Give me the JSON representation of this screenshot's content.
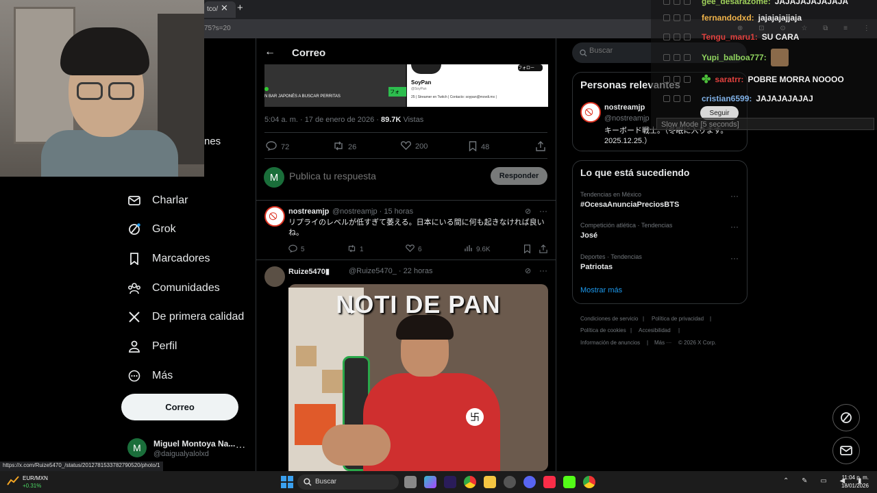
{
  "browser": {
    "tab_title": "tco/",
    "url": "75?s=20",
    "status_url": "https://x.com/Ruize5470_/status/2012781533782790520/photo/1"
  },
  "sidebar": {
    "partial_label": "nes",
    "items": [
      {
        "label": "Charlar",
        "icon": "envelope-icon"
      },
      {
        "label": "Grok",
        "icon": "grok-icon"
      },
      {
        "label": "Marcadores",
        "icon": "bookmark-icon"
      },
      {
        "label": "Comunidades",
        "icon": "communities-icon"
      },
      {
        "label": "De primera calidad",
        "icon": "x-logo-icon"
      },
      {
        "label": "Perfil",
        "icon": "person-icon"
      },
      {
        "label": "Más",
        "icon": "more-circle-icon"
      }
    ],
    "post_button": "Correo",
    "account": {
      "avatar_letter": "M",
      "name": "Miguel Montoya Na...",
      "handle": "@daigualyalolxd",
      "more": "···"
    }
  },
  "main": {
    "header_title": "Correo",
    "embed": {
      "caption": "N BAR JAPONÉS A BUSCAR PERRITAS",
      "follow_label": "フォ",
      "profile_name": "SoyPan",
      "profile_handle": "@SoyPan",
      "profile_bio": "25 | Streamer en Twitch | Contacto: soypan@movdi.mx |",
      "profile_button": "フォロー"
    },
    "post_meta": {
      "time": "5:04 a. m. · 17 de enero de 2026 ·",
      "views_count": "89.7K",
      "views_label": "Vistas"
    },
    "stats": {
      "replies": "72",
      "reposts": "26",
      "likes": "200",
      "bookmarks": "48"
    },
    "reply": {
      "avatar_letter": "M",
      "placeholder": "Publica tu respuesta",
      "button": "Responder"
    },
    "replies": [
      {
        "name": "nostreamjp",
        "handle": "@nostreamjp · 15 horas",
        "text": "リプライのレベルが低すぎて萎える。日本にいる間に何も起きなければ良いね。",
        "stats": {
          "replies": "5",
          "reposts": "1",
          "likes": "6",
          "views": "9.6K"
        }
      },
      {
        "name": "Ruize5470",
        "handle": "@Ruize5470_ · 22 horas",
        "image_text": "NOTI DE PAN"
      }
    ]
  },
  "right": {
    "search_placeholder": "Buscar",
    "relevant": {
      "title": "Personas relevantes",
      "name": "nostreamjp",
      "handle": "@nostreamjp",
      "bio": "キーボード戦士。（冬眠に入ります。2025.12.25.）"
    },
    "trends": {
      "title": "Lo que está sucediendo",
      "items": [
        {
          "meta": "Tendencias en México",
          "name": "#OcesaAnunciaPreciosBTS"
        },
        {
          "meta": "Competición atlética · Tendencias",
          "name": "José"
        },
        {
          "meta": "Deportes · Tendencias",
          "name": "Patriotas"
        }
      ],
      "show_more": "Mostrar más"
    },
    "footer": {
      "terms": "Condiciones de servicio",
      "privacy": "Política de privacidad",
      "cookies": "Política de cookies",
      "accessibility": "Accesibilidad",
      "ads": "Información de anuncios",
      "more": "Más ···",
      "copyright": "© 2026 X Corp."
    }
  },
  "chat": {
    "messages": [
      {
        "user": "gee_desarazome:",
        "msg": "JAJAJAJAJAJAJA",
        "color": "#9ecf5a"
      },
      {
        "user": "fernandodxd:",
        "msg": "jajajajajjaja",
        "color": "#f0b34a"
      },
      {
        "user": "Tengu_maru1:",
        "msg": "SU CARA",
        "color": "#e0413e"
      },
      {
        "user": "Yupi_balboa777:",
        "msg": "",
        "color": "#8fd35e"
      },
      {
        "user": "saratrr:",
        "msg": "POBRE MORRA NOOOO",
        "color": "#e0413e"
      },
      {
        "user": "cristian6599:",
        "msg": "JAJAJAJAJAJ",
        "color": "#7fb0e6"
      }
    ],
    "follow_button": "Seguir",
    "slow_mode": "Slow Mode [5 seconds]"
  },
  "taskbar": {
    "fx_label": "EUR/MXN",
    "fx_value": "+0.31%",
    "search_placeholder": "Buscar",
    "time": "11:04 p. m.",
    "date": "18/01/2026"
  }
}
